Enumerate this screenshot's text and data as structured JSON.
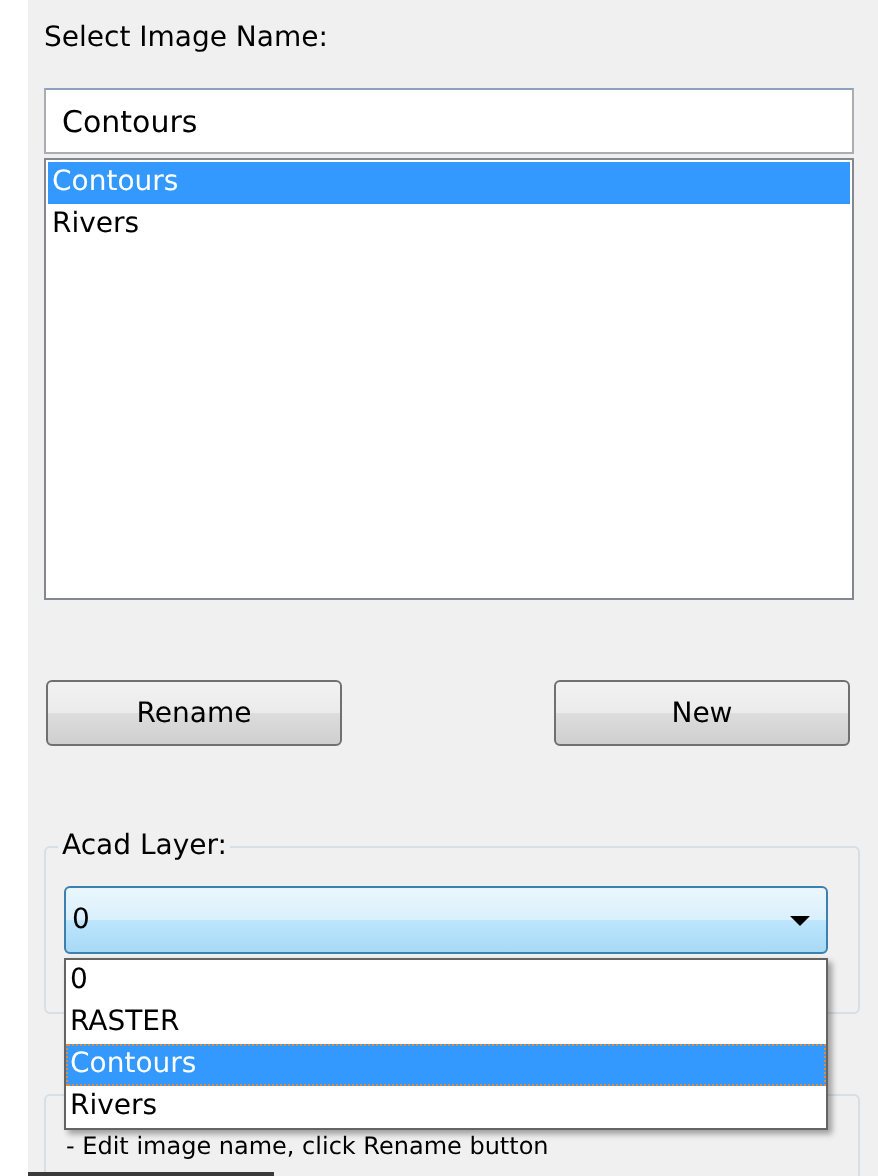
{
  "image_name": {
    "label": "Select Image Name:",
    "value": "Contours",
    "items": [
      {
        "label": "Contours",
        "selected": true
      },
      {
        "label": "Rivers",
        "selected": false
      }
    ]
  },
  "buttons": [
    "Rename",
    "New"
  ],
  "acad_layer": {
    "label": "Acad Layer:",
    "value": "0",
    "expanded": true,
    "options": [
      {
        "label": "0",
        "highlighted": false
      },
      {
        "label": "RASTER",
        "highlighted": false
      },
      {
        "label": "Contours",
        "highlighted": true
      },
      {
        "label": "Rivers",
        "highlighted": false
      }
    ]
  },
  "hint": {
    "text": "- Edit image name, click Rename button"
  }
}
